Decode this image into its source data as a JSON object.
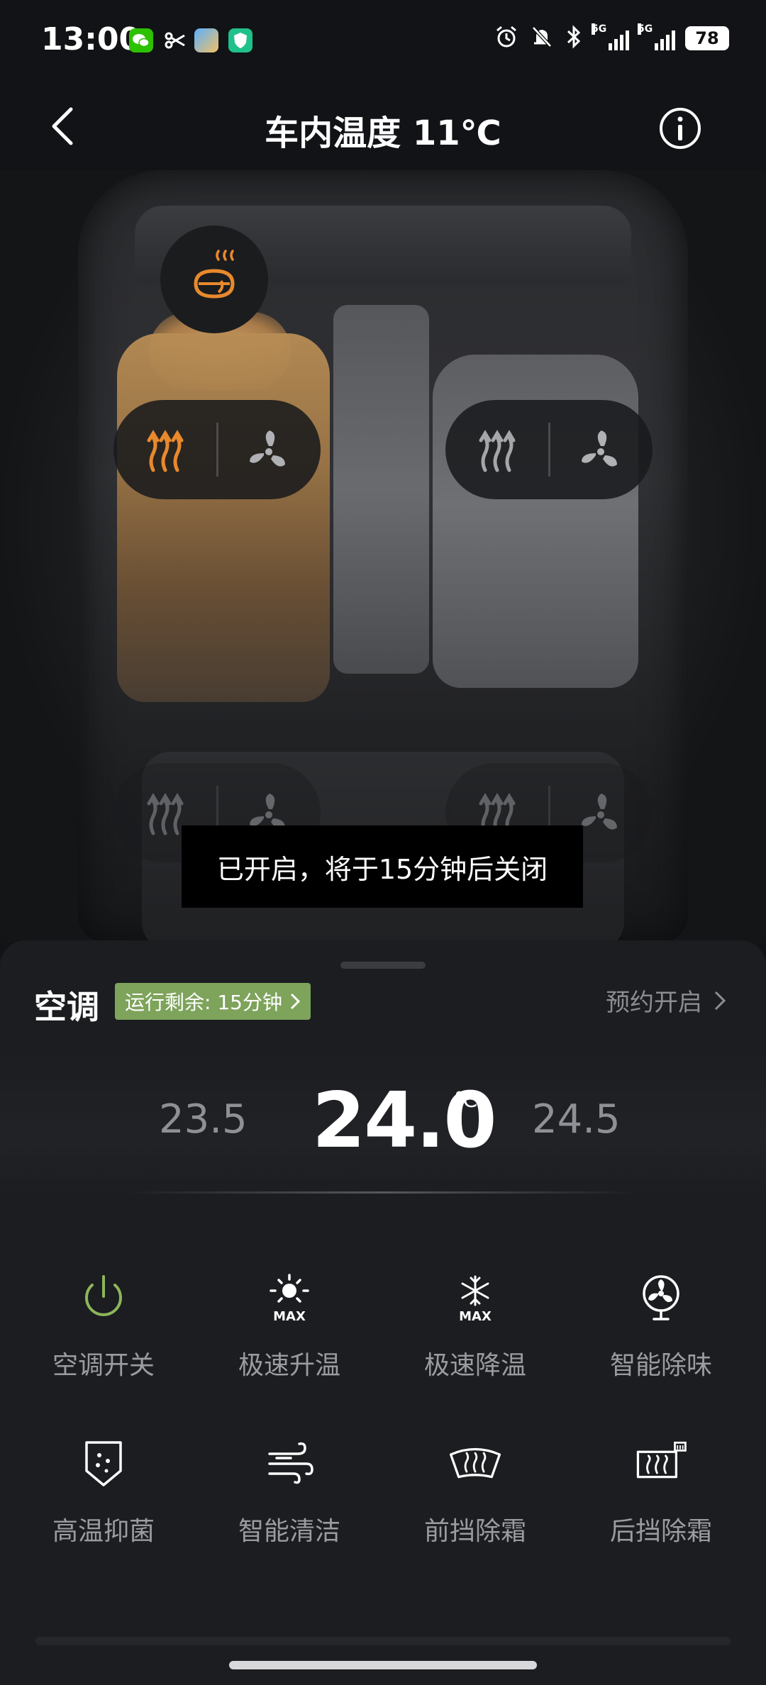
{
  "status_bar": {
    "time": "13:00",
    "left_icons": [
      "wechat-icon",
      "scissors-icon",
      "finder-icon",
      "shield-app-icon"
    ],
    "right_icons": [
      "alarm-icon",
      "bell-off-icon",
      "bluetooth-icon",
      "signal-5g-icon",
      "signal-5g-icon"
    ],
    "network_label_1": "5G",
    "network_label_2": "5G",
    "battery": "78"
  },
  "header": {
    "title": "车内温度 11℃"
  },
  "seat_controls": {
    "neck_heater_active": true,
    "front_left": {
      "heat_active": true,
      "fan_active": false
    },
    "front_right": {
      "heat_active": false,
      "fan_active": false
    },
    "rear_left": {
      "heat_active": false,
      "fan_active": false
    },
    "rear_right": {
      "heat_active": false,
      "fan_active": false
    }
  },
  "toast": {
    "message": "已开启，将于15分钟后关闭"
  },
  "ac": {
    "title": "空调",
    "run_badge": "运行剩余: 15分钟",
    "schedule_label": "预约开启",
    "temp_lower": "23.5",
    "temp_current": "24.0",
    "temp_unit": "℃",
    "temp_higher": "24.5"
  },
  "controls": [
    {
      "label": "空调开关",
      "icon": "power-icon",
      "active": true
    },
    {
      "label": "极速升温",
      "icon": "sun-max-icon",
      "active": false
    },
    {
      "label": "极速降温",
      "icon": "snowflake-max-icon",
      "active": false
    },
    {
      "label": "智能除味",
      "icon": "fan-icon",
      "active": false
    },
    {
      "label": "高温抑菌",
      "icon": "shield-dots-icon",
      "active": false
    },
    {
      "label": "智能清洁",
      "icon": "wind-icon",
      "active": false
    },
    {
      "label": "前挡除霜",
      "icon": "front-defrost-icon",
      "active": false
    },
    {
      "label": "后挡除霜",
      "icon": "rear-defrost-icon",
      "active": false
    }
  ],
  "colors": {
    "accent_orange": "#e8892d",
    "accent_green": "#7ea35b",
    "background": "#111316",
    "sheet": "#1b1d20"
  }
}
